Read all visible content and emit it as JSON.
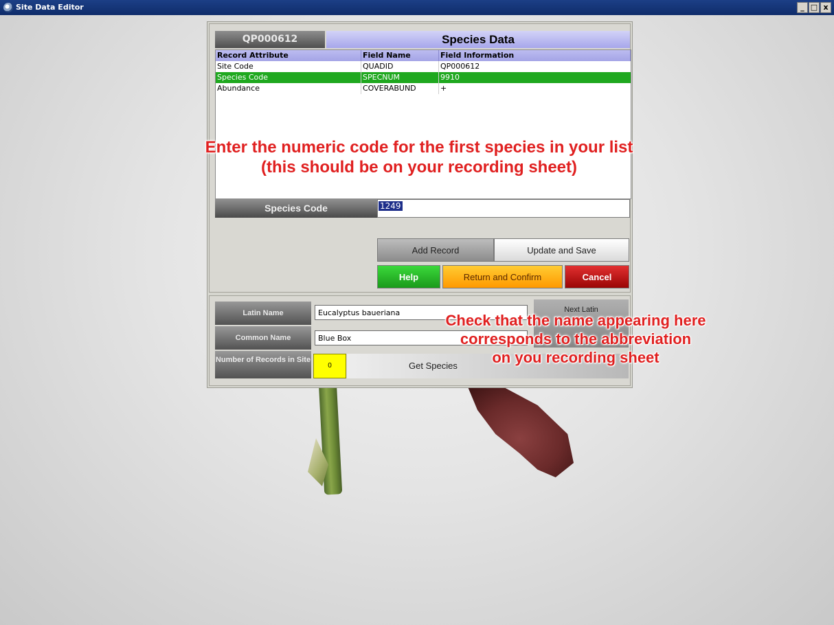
{
  "window": {
    "title": "Site Data Editor",
    "controls": [
      "_",
      "□",
      "x"
    ]
  },
  "top": {
    "site_code": "QP000612",
    "panel_title": "Species Data",
    "grid": {
      "headers": [
        "Record Attribute",
        "Field Name",
        "Field Information"
      ],
      "rows": [
        {
          "attribute": "Site Code",
          "field": "QUADID",
          "info": "QP000612",
          "selected": false
        },
        {
          "attribute": "Species Code",
          "field": "SPECNUM",
          "info": "9910",
          "selected": true
        },
        {
          "attribute": "Abundance",
          "field": "COVERABUND",
          "info": "+",
          "selected": false
        }
      ]
    },
    "species_code_label": "Species Code",
    "species_code_value": "1249",
    "buttons": {
      "add": "Add Record",
      "update": "Update and Save",
      "help": "Help",
      "return": "Return and Confirm",
      "cancel": "Cancel"
    }
  },
  "bottom": {
    "latin_label": "Latin Name",
    "latin_value": "Eucalyptus baueriana",
    "common_label": "Common Name",
    "common_value": "Blue Box",
    "count_label": "Number of Records in Site",
    "count_value": "0",
    "next_latin": "Next Latin",
    "get_species": "Get Species"
  },
  "annotations": {
    "top_line1": "Enter the numeric code for the first species in your list",
    "top_line2": "(this should be on your recording sheet)",
    "bottom_line1": "Check that the name appearing here",
    "bottom_line2": "corresponds to the abbreviation",
    "bottom_line3": "on you recording sheet"
  },
  "colors": {
    "selected_row": "#1fa81f",
    "annotation": "#e02020",
    "help": "#1b9a1b",
    "return": "#ff9900",
    "cancel": "#9a0505",
    "count_box": "#ffff00"
  }
}
